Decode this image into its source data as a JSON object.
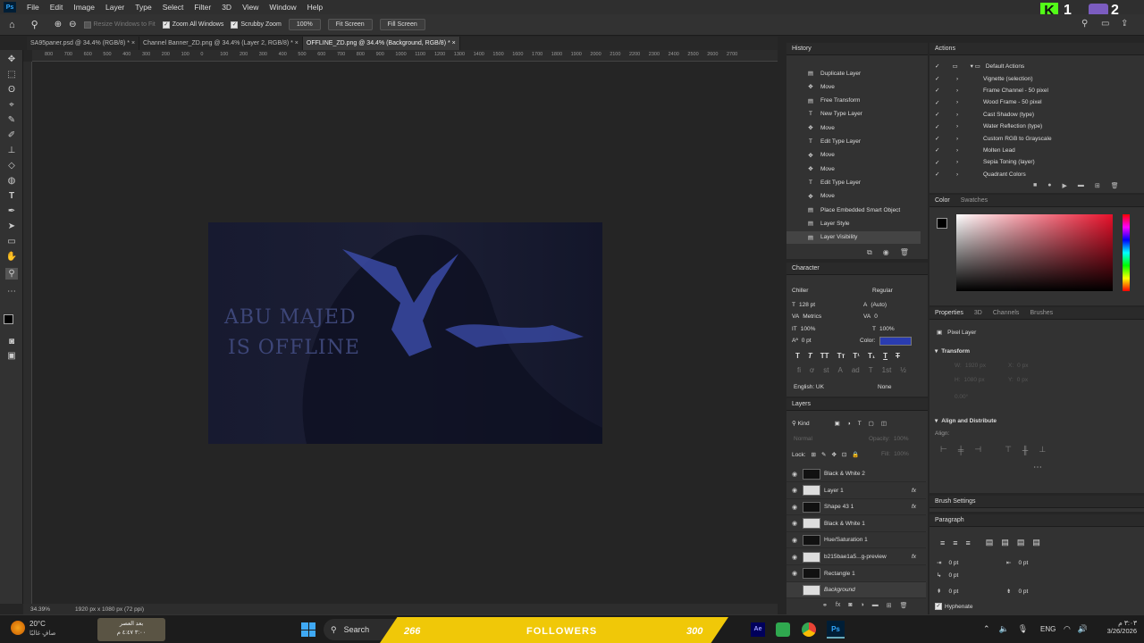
{
  "menu": [
    "File",
    "Edit",
    "Image",
    "Layer",
    "Type",
    "Select",
    "Filter",
    "3D",
    "View",
    "Window",
    "Help"
  ],
  "ps_logo": "Ps",
  "options": {
    "resize": "Resize Windows to Fit",
    "zoom_all": "Zoom All Windows",
    "scrubby": "Scrubby Zoom",
    "zoom_pct": "100%",
    "fit": "Fit Screen",
    "fill": "Fill Screen"
  },
  "brand": {
    "k_label": "K",
    "k_num": "1",
    "num2": "2"
  },
  "tabs": [
    "SA95paner.psd @ 34.4% (RGB/8) *",
    "Channel Banner_ZD.png @ 34.4% (Layer 2, RGB/8) *",
    "OFFLINE_ZD.png @ 34.4% (Background, RGB/8) *"
  ],
  "ruler": [
    "800",
    "700",
    "600",
    "500",
    "400",
    "300",
    "200",
    "100",
    "0",
    "100",
    "200",
    "300",
    "400",
    "500",
    "600",
    "700",
    "800",
    "900",
    "1000",
    "1100",
    "1200",
    "1300",
    "1400",
    "1500",
    "1600",
    "1700",
    "1800",
    "1900",
    "2000",
    "2100",
    "2200",
    "2300",
    "2400",
    "2500",
    "2600",
    "2700"
  ],
  "doc": {
    "line1": "ABU MAJED",
    "line2": "IS OFFLINE"
  },
  "status": {
    "zoom": "34.39%",
    "size": "1920 px x 1080 px (72 ppi)"
  },
  "history": {
    "title": "History",
    "items": [
      "Duplicate Layer",
      "Move",
      "Free Transform",
      "New Type Layer",
      "Move",
      "Edit Type Layer",
      "Move",
      "Move",
      "Edit Type Layer",
      "Move",
      "Place Embedded Smart Object",
      "Layer Style",
      "Layer Visibility"
    ],
    "icons": [
      "layer",
      "move",
      "layer",
      "type",
      "move",
      "type",
      "move",
      "move",
      "type",
      "move",
      "layer",
      "layer",
      "layer"
    ]
  },
  "actions": {
    "title": "Actions",
    "set": "Default Actions",
    "items": [
      "Vignette (selection)",
      "Frame Channel - 50 pixel",
      "Wood Frame - 50 pixel",
      "Cast Shadow (type)",
      "Water Reflection (type)",
      "Custom RGB to Grayscale",
      "Molten Lead",
      "Sepia Toning (layer)",
      "Quadrant Colors"
    ]
  },
  "color": {
    "tab1": "Color",
    "tab2": "Swatches"
  },
  "character": {
    "title": "Character",
    "font": "Chiller",
    "style": "Regular",
    "size": "128 pt",
    "leading": "(Auto)",
    "kerning": "Metrics",
    "tracking": "0",
    "vscale": "100%",
    "hscale": "100%",
    "baseline": "0 pt",
    "color_label": "Color:",
    "language": "English: UK",
    "aa": "None",
    "color_hex": "#2a3cb0"
  },
  "properties": {
    "tabs": [
      "Properties",
      "3D",
      "Channels",
      "Brushes"
    ],
    "kind": "Pixel Layer",
    "transform": "Transform",
    "align": "Align and Distribute",
    "align_label": "Align:",
    "w": "W:",
    "h": "H:",
    "x": "X:",
    "y": "Y:",
    "wv": "1920 px",
    "hv": "1080 px",
    "xv": "0 px",
    "yv": "0 px",
    "ang": "0.00°"
  },
  "layers": {
    "title": "Layers",
    "kind": "Kind",
    "blend": "Normal",
    "opacity_label": "Opacity:",
    "opacity": "100%",
    "lock": "Lock:",
    "fill_label": "Fill:",
    "fill": "100%",
    "items": [
      {
        "name": "Black & White 2",
        "fx": ""
      },
      {
        "name": "Layer 1",
        "fx": "fx"
      },
      {
        "name": "Shape 43 1",
        "fx": "fx"
      },
      {
        "name": "Black & White 1",
        "fx": ""
      },
      {
        "name": "Hue/Saturation 1",
        "fx": ""
      },
      {
        "name": "b215bae1a5...g-preview",
        "fx": "fx"
      },
      {
        "name": "Rectangle 1",
        "fx": ""
      },
      {
        "name": "Background",
        "fx": ""
      }
    ]
  },
  "brush": {
    "title": "Brush Settings"
  },
  "paragraph": {
    "title": "Paragraph",
    "v1": "0 pt",
    "v2": "0 pt",
    "v3": "0 pt",
    "v4": "0 pt",
    "v5": "0 pt",
    "hyphenate": "Hyphenate"
  },
  "taskbar": {
    "temp": "20°C",
    "weather": "صافٍ غالبًا",
    "prayer_a": "بعد",
    "prayer_b": "العصر",
    "prayer_c": "٣:٠٠",
    "prayer_d": "٤:٤٧ م",
    "search": "Search",
    "stream_left": "266",
    "stream_mid": "FOLLOWERS",
    "stream_right": "300",
    "lang": "ENG",
    "time": "٣:٠٣ م",
    "date": "3/26/2026"
  }
}
